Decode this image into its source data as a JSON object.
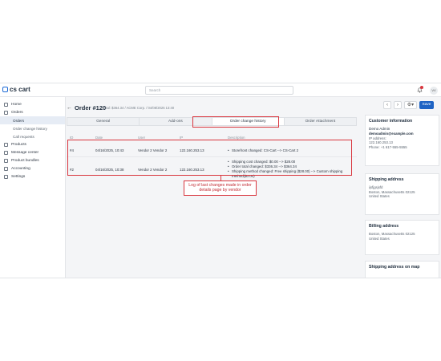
{
  "brand": {
    "logo_text": "cs cart"
  },
  "search": {
    "placeholder": "Search"
  },
  "topbar": {
    "avatar_initials": "VV",
    "notification_count": "2"
  },
  "sidebar": {
    "items": [
      {
        "label": "Home",
        "icon": "home-icon"
      },
      {
        "label": "Orders",
        "icon": "orders-icon"
      },
      {
        "label": "Products",
        "icon": "tag-icon"
      },
      {
        "label": "Message center",
        "icon": "message-icon"
      },
      {
        "label": "Product bundles",
        "icon": "bundle-icon"
      },
      {
        "label": "Accounting",
        "icon": "accounting-icon"
      },
      {
        "label": "Settings",
        "icon": "settings-icon"
      }
    ],
    "sub_items": [
      {
        "label": "Orders"
      },
      {
        "label": "Order change history"
      },
      {
        "label": "Call requests"
      }
    ]
  },
  "order": {
    "title": "Order #120",
    "subtitle": "Total: $364.34 / ACME Corp. / 04/08/2025 13:40"
  },
  "tabs": [
    {
      "label": "General"
    },
    {
      "label": "Add-ons"
    },
    {
      "label": "Order change history"
    },
    {
      "label": "Order Attachment"
    }
  ],
  "table": {
    "headers": {
      "id": "ID",
      "date": "Date",
      "user": "User",
      "ip": "IP",
      "description": "Description"
    },
    "rows": [
      {
        "id": "#4",
        "date": "04/16/2025, 10:43",
        "user": "Vendor 2 Vendor 2",
        "ip": "122.160.253.13",
        "description": [
          "Storefront changed: CS-Cart --> CS-Cart 2"
        ]
      },
      {
        "id": "#2",
        "date": "04/16/2025, 10:38",
        "user": "Vendor 2 Vendor 2",
        "ip": "122.160.253.13",
        "description": [
          "Shipping cost changed: $0.00 --> $28.00",
          "Order total changed: $336.34 --> $364.34",
          "Shipping method changed: Free shipping ($28.00) --> Custom shipping method($0.00)"
        ]
      }
    ]
  },
  "annotation": {
    "text": "Log of last changes made in order details page by vendor"
  },
  "toolbar": {
    "save_label": "Save"
  },
  "customer": {
    "title": "Customer information",
    "name": "Demo Admin",
    "email": "demoadmin@example.com",
    "ip_label": "IP address:",
    "ip": "122.160.253.13",
    "phone": "Phone: +1 617-555-5555"
  },
  "shipping": {
    "title": "Shipping address",
    "address1": "ijsfjgsjsfd",
    "address2": "Boston, Massachusetts 02125",
    "country": "United States"
  },
  "billing": {
    "title": "Billing address",
    "address1": "Boston, Massachusetts 02125",
    "country": "United States"
  },
  "map": {
    "title": "Shipping address on map"
  },
  "colors": {
    "accent": "#1e63c4",
    "highlight": "#d9363e"
  }
}
